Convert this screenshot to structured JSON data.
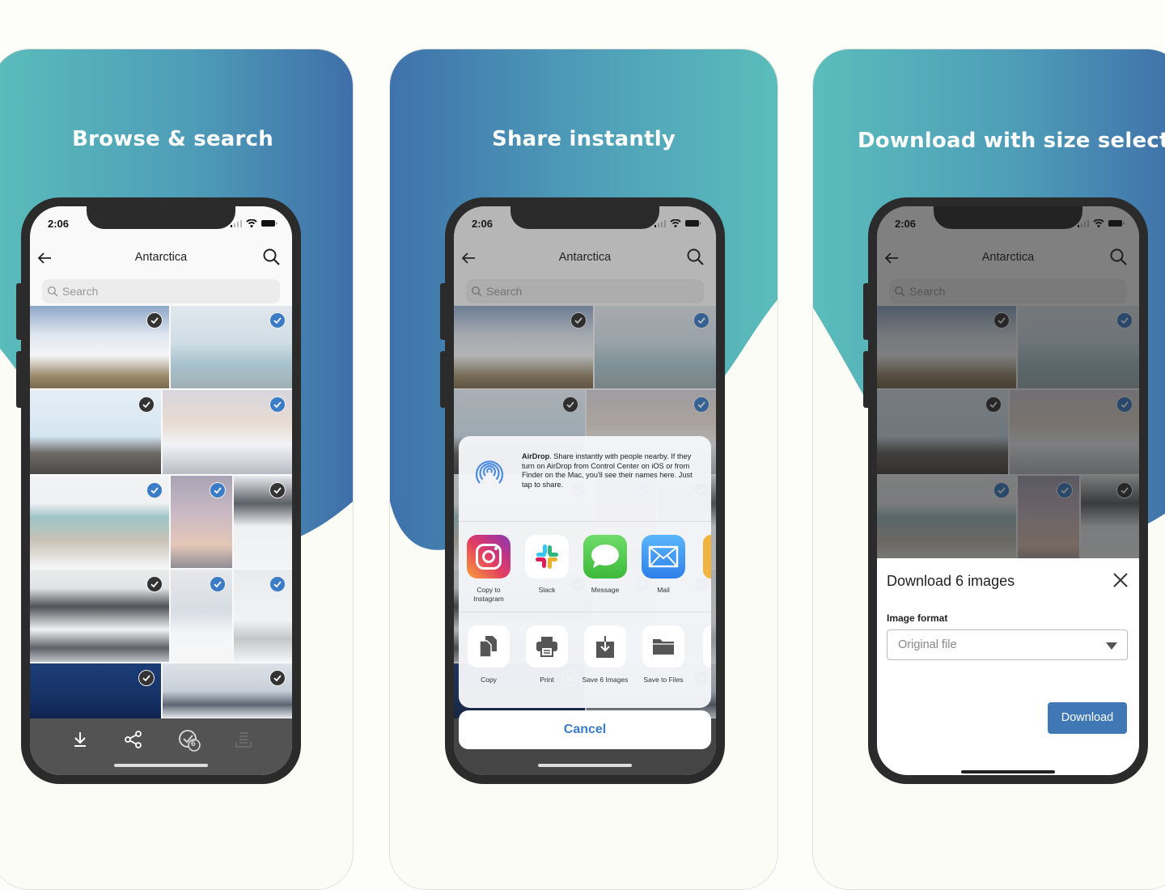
{
  "colors": {
    "teal": "#5bbdbb",
    "blue": "#3f72ab",
    "accent_blue": "#3a7cc6",
    "phone_frame": "#2b2b2b",
    "card_bg": "#fcfcf7"
  },
  "panels": [
    {
      "heading": "Browse & search",
      "status_time": "2:06",
      "nav_title": "Antarctica",
      "search_placeholder": "Search",
      "toolbar": {
        "download": "download-icon",
        "share": "share-icon",
        "selected_count": "6",
        "list": "list-icon"
      }
    },
    {
      "heading": "Share instantly",
      "status_time": "2:06",
      "nav_title": "Antarctica",
      "search_placeholder": "Search",
      "airdrop": {
        "title": "AirDrop",
        "text": ". Share instantly with people nearby. If they turn on AirDrop from Control Center on iOS or from Finder on the Mac, you'll see their names here. Just tap to share."
      },
      "apps": [
        {
          "label": "Copy to Instagram",
          "icon": "instagram-icon"
        },
        {
          "label": "Slack",
          "icon": "slack-icon"
        },
        {
          "label": "Message",
          "icon": "message-icon"
        },
        {
          "label": "Mail",
          "icon": "mail-icon"
        }
      ],
      "actions": [
        {
          "label": "Copy",
          "icon": "copy-icon"
        },
        {
          "label": "Print",
          "icon": "print-icon"
        },
        {
          "label": "Save 6 Images",
          "icon": "save-images-icon"
        },
        {
          "label": "Save to Files",
          "icon": "folder-icon"
        }
      ],
      "cancel_label": "Cancel"
    },
    {
      "heading": "Download with size selection",
      "status_time": "2:06",
      "nav_title": "Antarctica",
      "search_placeholder": "Search",
      "dialog": {
        "title": "Download 6 images",
        "format_label": "Image format",
        "format_value": "Original file",
        "download_label": "Download"
      }
    }
  ],
  "photos": [
    {
      "subject": "halo over bay with hikers",
      "selected_style": "dark"
    },
    {
      "subject": "iceberg",
      "selected_style": "blue"
    },
    {
      "subject": "penguin on rocks",
      "selected_style": "dark"
    },
    {
      "subject": "snowy mountains at dusk",
      "selected_style": "blue"
    },
    {
      "subject": "blue hut",
      "selected_style": "blue"
    },
    {
      "subject": "pink sky",
      "selected_style": "blue"
    },
    {
      "subject": "hikers and penguin",
      "selected_style": "dark"
    },
    {
      "subject": "cliff with zodiac boat",
      "selected_style": "dark"
    },
    {
      "subject": "hikers on snow slope",
      "selected_style": "blue"
    },
    {
      "subject": "seal on snow",
      "selected_style": "blue"
    },
    {
      "subject": "whale",
      "selected_style": "dark"
    },
    {
      "subject": "mountain range",
      "selected_style": "dark"
    }
  ]
}
